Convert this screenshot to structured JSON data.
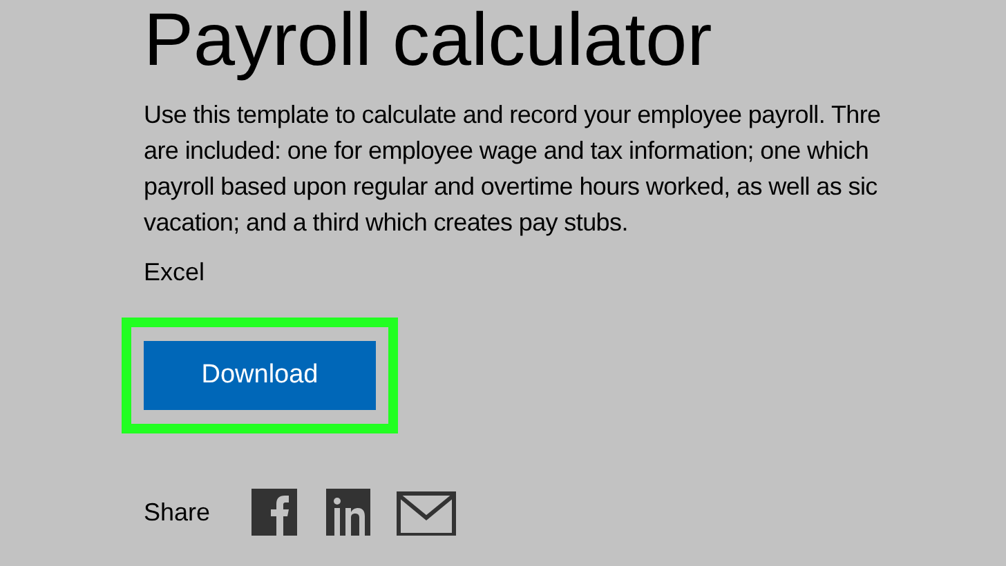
{
  "title": "Payroll calculator",
  "description": [
    "Use this template to calculate and record your employee payroll. Thre",
    "are included: one for employee wage and tax information; one which",
    "payroll based upon regular and overtime hours worked, as well as sic",
    "vacation; and a third which creates pay stubs."
  ],
  "file_type": "Excel",
  "download_button": {
    "label": "Download"
  },
  "share": {
    "label": "Share"
  }
}
